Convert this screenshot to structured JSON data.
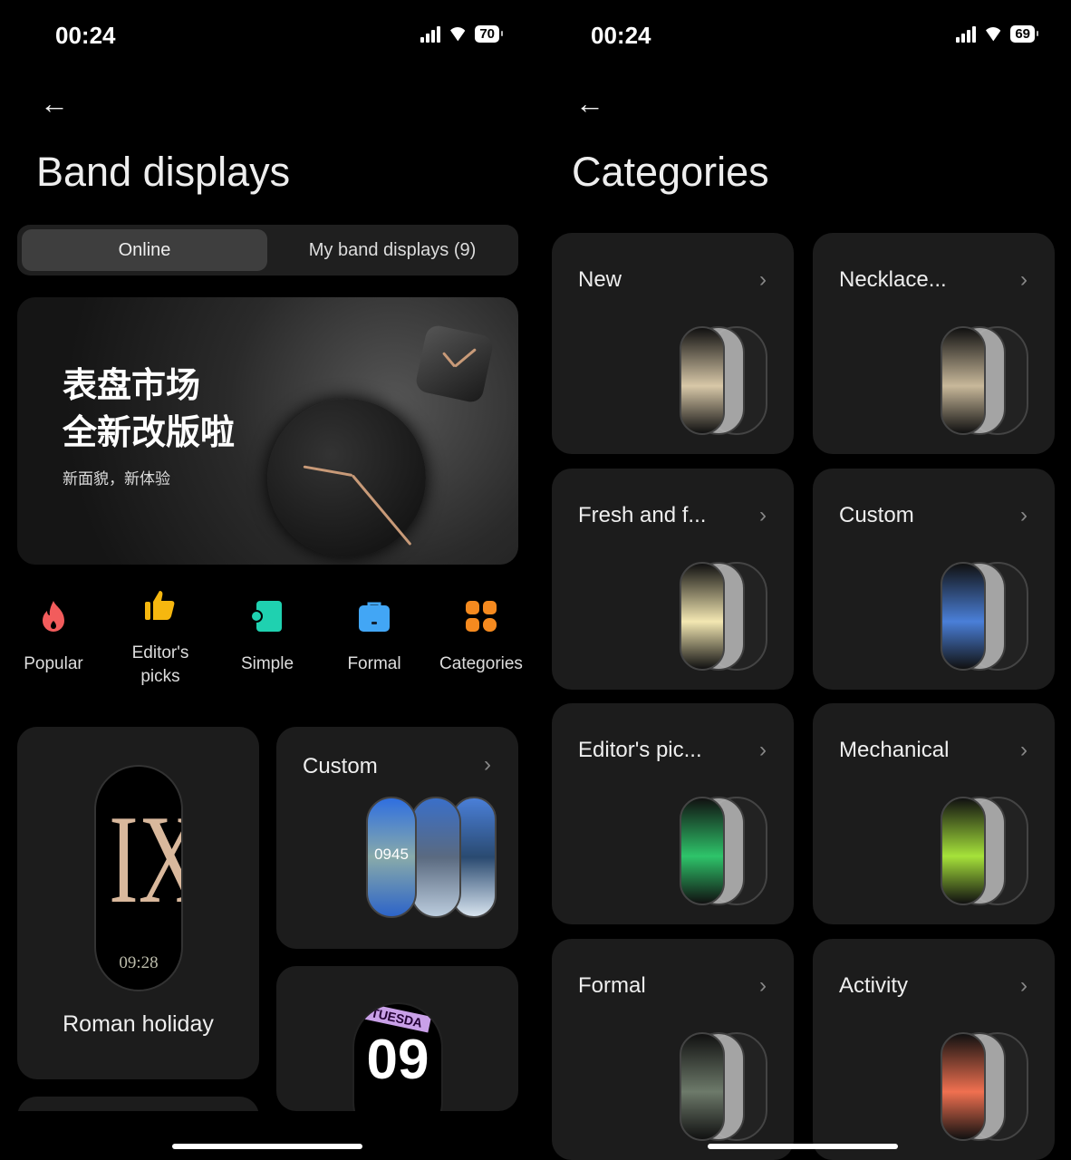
{
  "left": {
    "status": {
      "time": "00:24",
      "battery": "70"
    },
    "title": "Band displays",
    "tabs": [
      {
        "label": "Online",
        "active": true
      },
      {
        "label": "My band displays (9)",
        "active": false
      }
    ],
    "banner": {
      "line1": "表盘市场",
      "line2": "全新改版啦",
      "subtitle": "新面貌，新体验"
    },
    "quick_categories": [
      {
        "label": "Popular",
        "icon": "flame-icon",
        "color": "#f25c5c"
      },
      {
        "label": "Editor's picks",
        "icon": "thumbs-up-icon",
        "color": "#f6b70f"
      },
      {
        "label": "Simple",
        "icon": "simple-icon",
        "color": "#1fd1b0"
      },
      {
        "label": "Formal",
        "icon": "briefcase-icon",
        "color": "#42a6f5"
      },
      {
        "label": "Categories",
        "icon": "grid-icon",
        "color": "#f58a1f"
      }
    ],
    "featured": {
      "name": "Roman holiday",
      "numeral": "IX",
      "time": "09:28"
    },
    "custom_card": {
      "label": "Custom",
      "face_time": "0945"
    },
    "partial_card": {
      "text": "09",
      "banner": "TUESDA"
    }
  },
  "right": {
    "status": {
      "time": "00:24",
      "battery": "69"
    },
    "title": "Categories",
    "categories": [
      {
        "label": "New",
        "theme": "#d8c8a8"
      },
      {
        "label": "Necklace...",
        "theme": "#c8b89a"
      },
      {
        "label": "Fresh and f...",
        "theme": "#f3e7b2"
      },
      {
        "label": "Custom",
        "theme": "#4a7fd8"
      },
      {
        "label": "Editor's pic...",
        "theme": "#2ec46a"
      },
      {
        "label": "Mechanical",
        "theme": "#a6e23a"
      },
      {
        "label": "Formal",
        "theme": "#6d7a6a"
      },
      {
        "label": "Activity",
        "theme": "#f07050"
      }
    ]
  }
}
